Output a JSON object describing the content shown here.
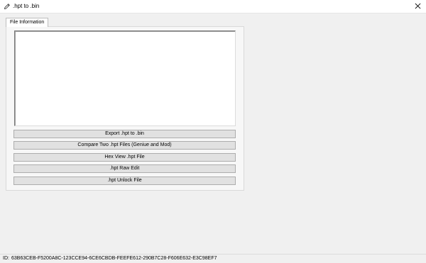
{
  "window": {
    "title": ".hpt to .bin"
  },
  "tabs": [
    {
      "label": "File Information"
    }
  ],
  "main": {
    "info_text": "",
    "buttons": {
      "export": "Export .hpt to .bin",
      "compare": "Compare Two .hpt Files (Geniue and Mod)",
      "hex_view": "Hex View .hpt File",
      "raw_edit": ".hpt Raw Edit",
      "unlock": ".hpt Unlock File"
    }
  },
  "status": {
    "id_label": "ID:",
    "id_value": "63B63CEB-F5200A8C-123CCE94-6CE6CBDB-FEEFE612-290B7C28-F606E632-E3C98EF7"
  },
  "icons": {
    "app": "pencil-icon",
    "close": "close-icon"
  }
}
